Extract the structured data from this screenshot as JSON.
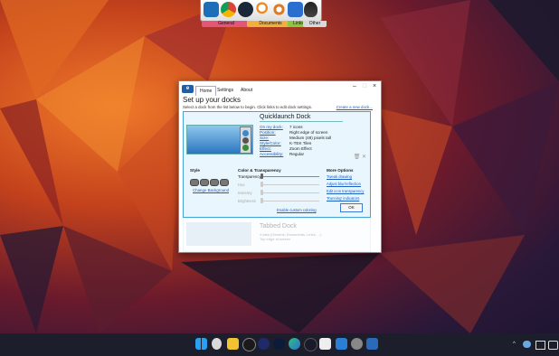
{
  "top_dock": {
    "icons": [
      "dock-app-icon",
      "chrome-icon",
      "steam-icon",
      "search-icon",
      "network-icon",
      "linux-penguin-icon"
    ],
    "tabs": [
      {
        "label": "General",
        "color": "#e4557a"
      },
      {
        "label": "Documents",
        "color": "#f0b040"
      },
      {
        "label": "Links",
        "color": "#8ac640"
      },
      {
        "label": "Other",
        "color": "#d8d8d8"
      }
    ]
  },
  "window": {
    "tabs": [
      "Home",
      "Settings",
      "About"
    ],
    "active_tab": "Home",
    "heading": "Set up your docks",
    "subtext": "Select a dock from the list below to begin. Click links to edit dock settings.",
    "create_link": "Create a new dock...",
    "dock": {
      "name": "Quicklaunch Dock",
      "properties": [
        {
          "label": "On my dock:",
          "value": "7 icons"
        },
        {
          "label": "Position:",
          "value": "Right edge of screen"
        },
        {
          "label": "Size:",
          "value": "Medium (48) pixels tall"
        },
        {
          "label": "Style/Color:",
          "value": "K-TEK Tiles"
        },
        {
          "label": "Effect:",
          "value": "Zoom Effect"
        },
        {
          "label": "Accessibility:",
          "value": "Regular"
        }
      ],
      "style_heading": "Style",
      "change_background": "Change Background",
      "color_heading": "Color & Transparency",
      "sliders": [
        {
          "label": "Transparency",
          "enabled": true,
          "value": 0
        },
        {
          "label": "Hue",
          "enabled": false,
          "value": 0
        },
        {
          "label": "Intensity",
          "enabled": false,
          "value": 0
        },
        {
          "label": "Brightness",
          "enabled": false,
          "value": 0
        }
      ],
      "enable_custom_coloring": "Enable custom coloring",
      "more_heading": "More Options",
      "more_links": [
        "Tweak drawing",
        "Adjust blur/reflection",
        "Edit icon transparency",
        "'Running' indicators"
      ],
      "ok_label": "OK"
    },
    "dock2": {
      "name": "Tabbed Dock",
      "line1": "4 tabs (General, Documents, Links, ...)",
      "line2": "Top edge of screen"
    }
  },
  "taskbar": {
    "icons": [
      "windows-start-icon",
      "weather-icon",
      "file-explorer-icon",
      "password-manager-icon",
      "app-icon",
      "app-icon-2",
      "edge-icon",
      "browser-icon",
      "notion-icon",
      "mail-icon",
      "terminal-icon",
      "settings-icon",
      "dock-app-icon"
    ],
    "tray": [
      "chevron-up-icon",
      "onedrive-icon",
      "display-icon",
      "network-icon"
    ]
  }
}
